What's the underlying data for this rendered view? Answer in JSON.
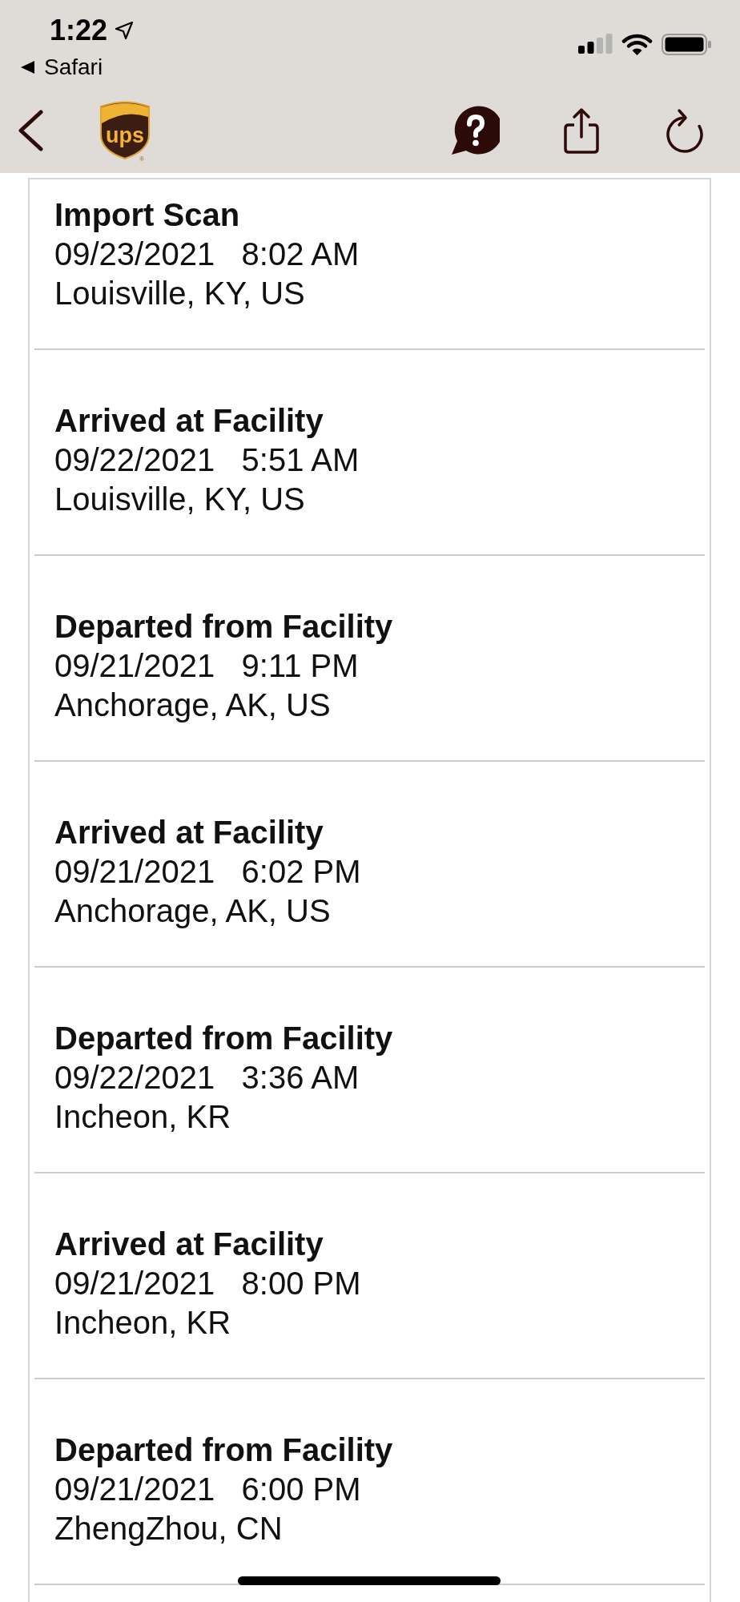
{
  "status_bar": {
    "time": "1:22",
    "back_link": "Safari"
  },
  "toolbar": {
    "logo": {
      "text": "ups",
      "mark": "®"
    }
  },
  "events": [
    {
      "title": "Import Scan",
      "datetime": "09/23/2021   8:02 AM",
      "location": "Louisville, KY, US"
    },
    {
      "title": "Arrived at Facility",
      "datetime": "09/22/2021   5:51 AM",
      "location": "Louisville, KY, US"
    },
    {
      "title": "Departed from Facility",
      "datetime": "09/21/2021   9:11 PM",
      "location": "Anchorage, AK, US"
    },
    {
      "title": "Arrived at Facility",
      "datetime": "09/21/2021   6:02 PM",
      "location": "Anchorage, AK, US"
    },
    {
      "title": "Departed from Facility",
      "datetime": "09/22/2021   3:36 AM",
      "location": "Incheon, KR"
    },
    {
      "title": "Arrived at Facility",
      "datetime": "09/21/2021   8:00 PM",
      "location": "Incheon, KR"
    },
    {
      "title": "Departed from Facility",
      "datetime": "09/21/2021   6:00 PM",
      "location": "ZhengZhou, CN"
    }
  ]
}
